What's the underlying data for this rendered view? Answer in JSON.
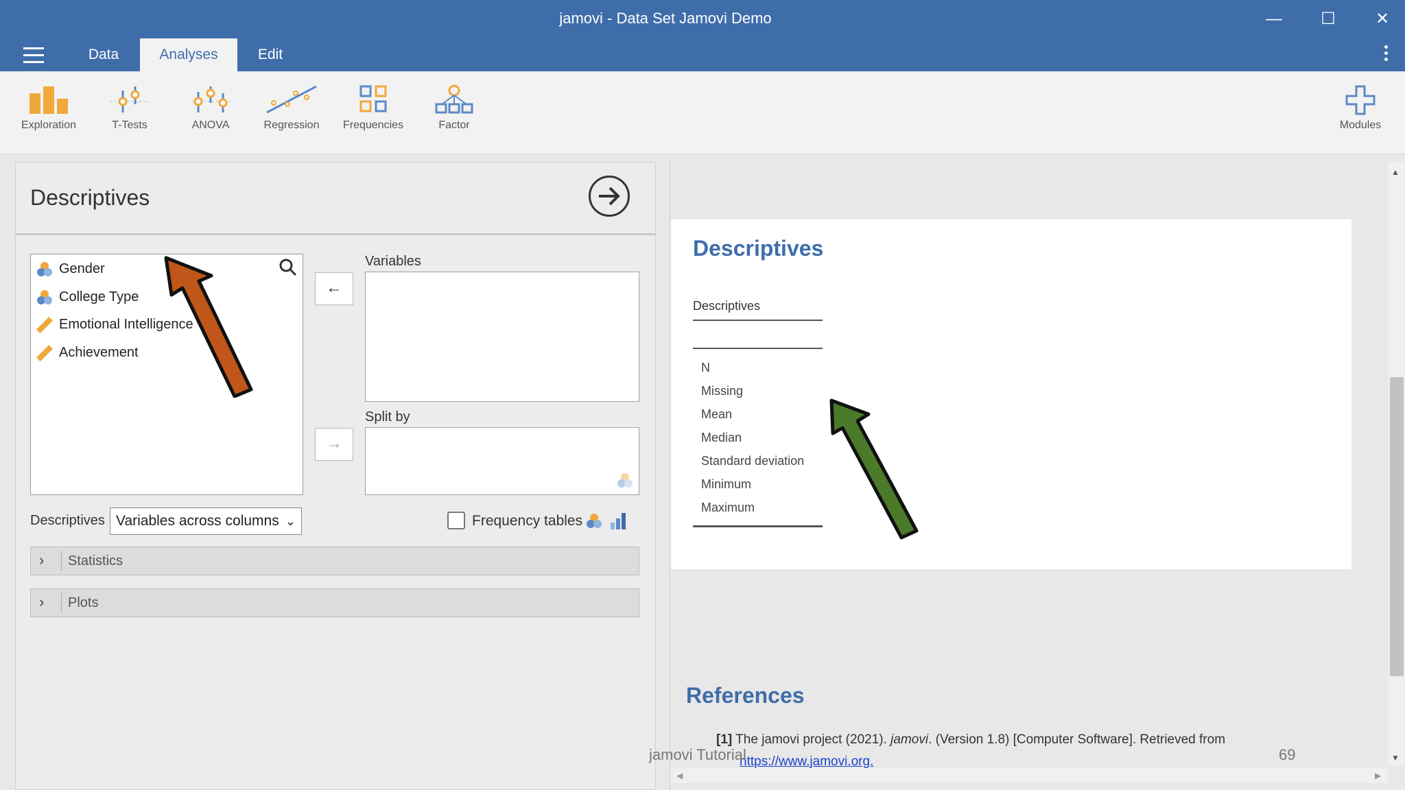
{
  "window": {
    "title": "jamovi - Data Set Jamovi Demo",
    "minimize": "—",
    "maximize": "☐",
    "close": "✕"
  },
  "tabs": [
    {
      "label": "Data"
    },
    {
      "label": "Analyses"
    },
    {
      "label": "Edit"
    }
  ],
  "ribbon": {
    "items": [
      {
        "label": "Exploration",
        "icon": "exploration-icon"
      },
      {
        "label": "T-Tests",
        "icon": "t-tests-icon"
      },
      {
        "label": "ANOVA",
        "icon": "anova-icon"
      },
      {
        "label": "Regression",
        "icon": "regression-icon"
      },
      {
        "label": "Frequencies",
        "icon": "frequencies-icon"
      },
      {
        "label": "Factor",
        "icon": "factor-icon"
      }
    ],
    "modules": "Modules"
  },
  "panel": {
    "title": "Descriptives",
    "variables": [
      "Gender",
      "College Type",
      "Emotional Intelligence",
      "Achievement"
    ],
    "variables_box_label": "Variables",
    "splitby_label": "Split by",
    "descriptives_label": "Descriptives",
    "descriptives_select": "Variables across columns",
    "frequency_tables_label": "Frequency tables",
    "sections": [
      {
        "label": "Statistics"
      },
      {
        "label": "Plots"
      }
    ]
  },
  "results": {
    "title": "Descriptives",
    "table_title": "Descriptives",
    "rows": [
      "N",
      "Missing",
      "Mean",
      "Median",
      "Standard deviation",
      "Minimum",
      "Maximum"
    ],
    "references_title": "References",
    "reference_num": "[1]",
    "reference_text": "The jamovi project (2021).",
    "reference_italic": "jamovi",
    "reference_tail": ". (Version 1.8) [Computer Software]. Retrieved from",
    "reference_link": "https://www.jamovi.org."
  },
  "footer": {
    "left": "jamovi Tutorial",
    "page": "69"
  },
  "colors": {
    "accent": "#3e6daa",
    "annotation_orange": "#c0561a",
    "annotation_green": "#4a7a2a"
  }
}
